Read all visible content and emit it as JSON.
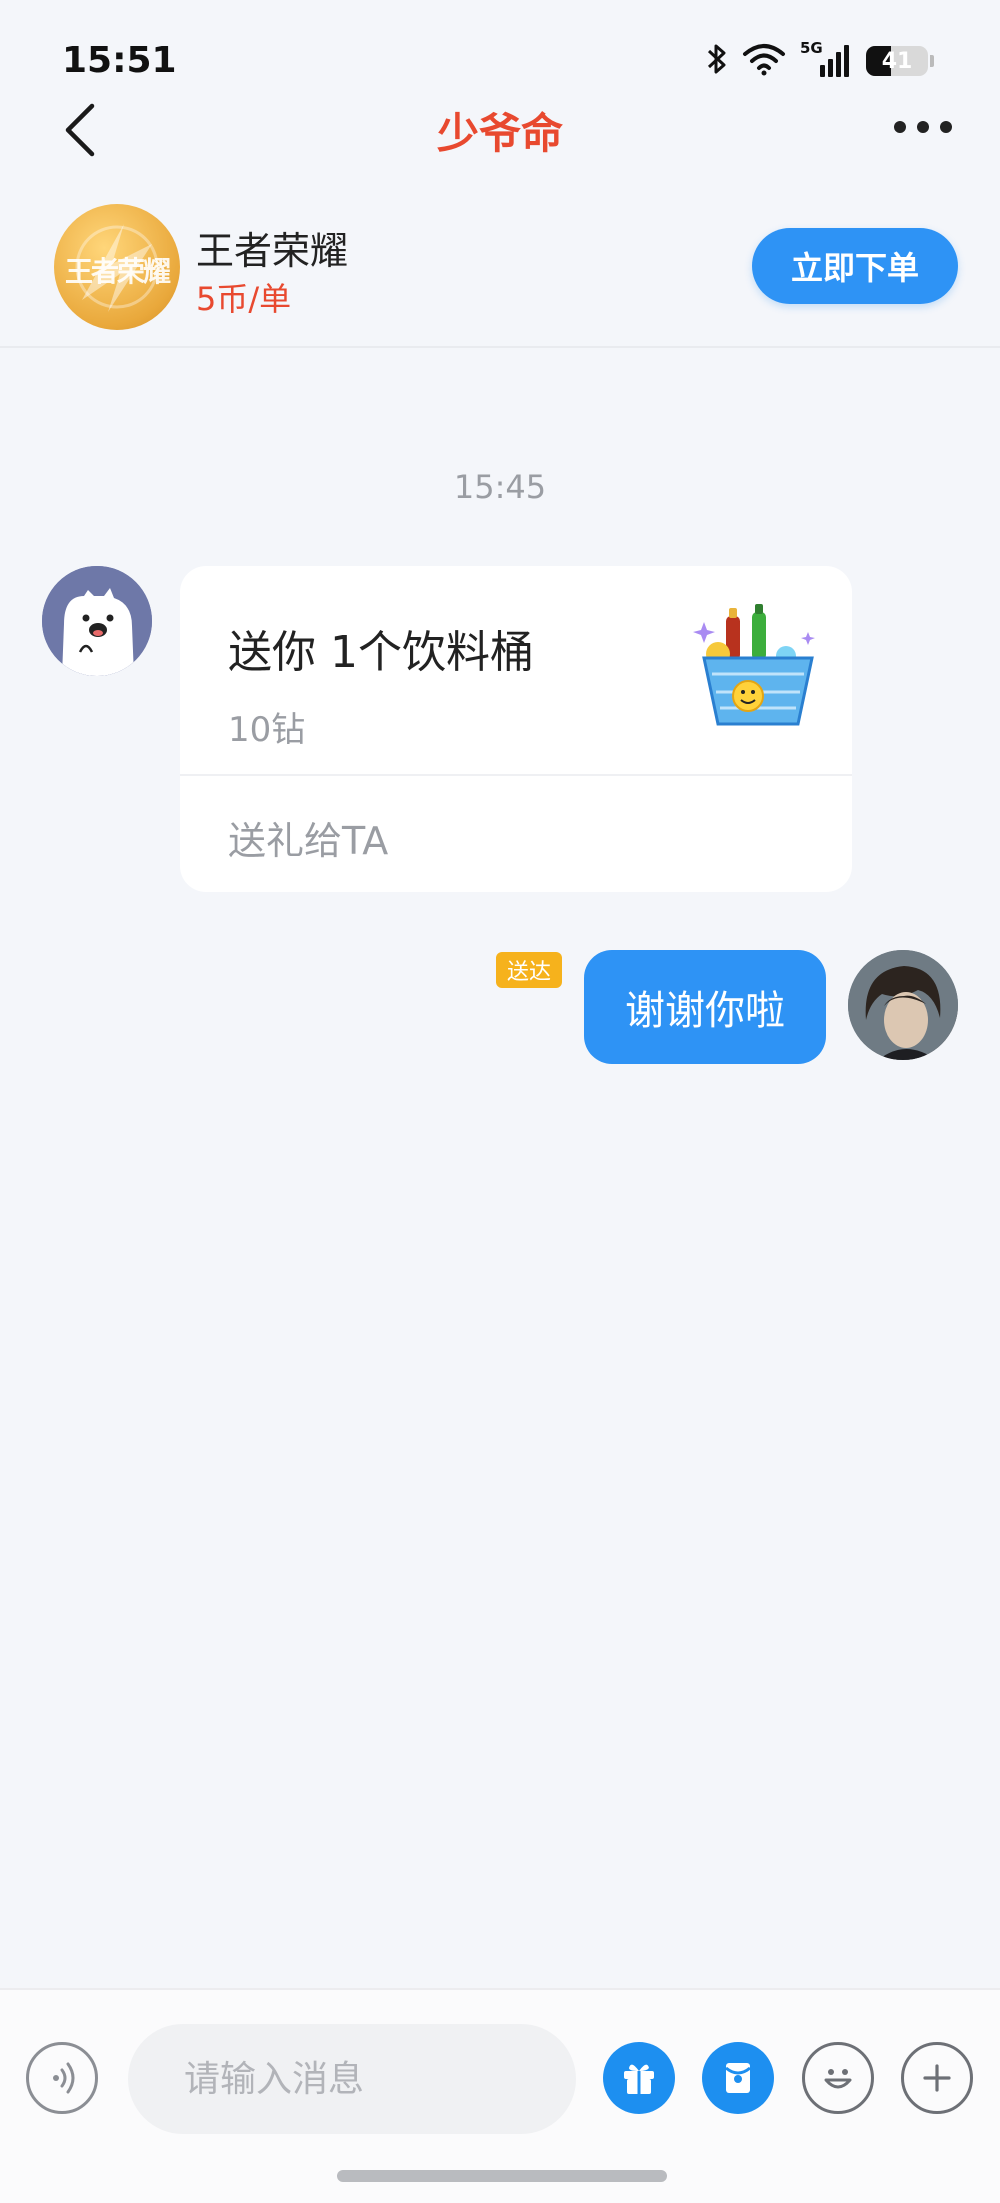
{
  "status_bar": {
    "time": "15:51",
    "network": "5G",
    "battery": "41",
    "battery_level": 0.41,
    "icons": [
      "bluetooth-icon",
      "wifi-icon",
      "signal-icon",
      "battery-icon"
    ]
  },
  "header": {
    "title": "少爷命",
    "back_icon": "chevron-left-icon",
    "more_icon": "more-dots-icon"
  },
  "service": {
    "logo_text": "王者荣耀",
    "name": "王者荣耀",
    "price": "5币/单",
    "order_button": "立即下单"
  },
  "chat": {
    "timestamp": "15:45",
    "messages": [
      {
        "type": "gift",
        "side": "left",
        "title": "送你 1个饮料桶",
        "price": "10钻",
        "action": "送礼给TA"
      },
      {
        "type": "text",
        "side": "right",
        "text": "谢谢你啦",
        "status": "送达"
      }
    ]
  },
  "input_bar": {
    "placeholder": "请输入消息",
    "buttons": [
      "voice-icon",
      "gift-icon",
      "red-packet-icon",
      "emoji-icon",
      "plus-icon"
    ]
  },
  "colors": {
    "accent_blue": "#2e93f5",
    "title_red": "#e8492f",
    "badge_yellow": "#f6b21c",
    "background": "#f4f6fa"
  }
}
